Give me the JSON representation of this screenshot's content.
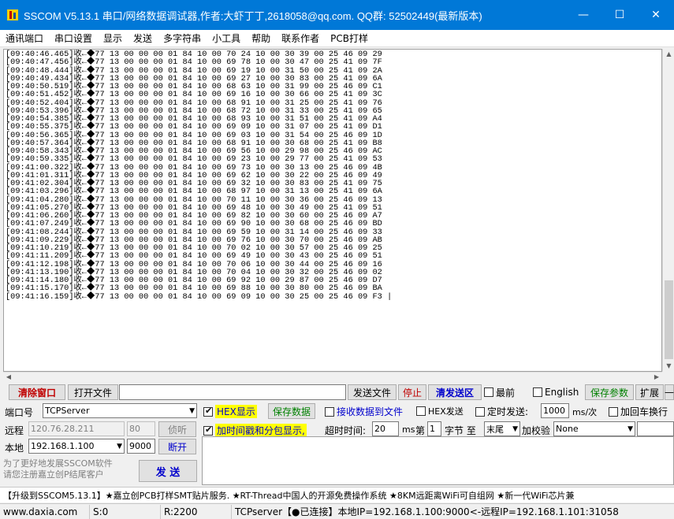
{
  "window": {
    "title": "SSCOM V5.13.1 串口/网络数据调试器,作者:大虾丁丁,2618058@qq.com. QQ群: 52502449(最新版本)",
    "minimize": "—",
    "maximize": "☐",
    "close": "✕"
  },
  "menu": [
    "通讯端口",
    "串口设置",
    "显示",
    "发送",
    "多字符串",
    "小工具",
    "帮助",
    "联系作者",
    "PCB打样"
  ],
  "log": [
    "[09:40:46.465]收←◆77 13 00 00 00 01 84 10 00 70 24 10 00 30 39 00 25 46 09 29",
    "[09:40:47.456]收←◆77 13 00 00 00 01 84 10 00 69 78 10 00 30 47 00 25 41 09 7F",
    "[09:40:48.444]收←◆77 13 00 00 00 01 84 10 00 69 19 10 00 31 50 00 25 41 09 2A",
    "[09:40:49.434]收←◆77 13 00 00 00 01 84 10 00 69 27 10 00 30 83 00 25 41 09 6A",
    "[09:40:50.519]收←◆77 13 00 00 00 01 84 10 00 68 63 10 00 31 99 00 25 46 09 C1",
    "[09:40:51.452]收←◆77 13 00 00 00 01 84 10 00 69 16 10 00 30 66 00 25 41 09 3C",
    "[09:40:52.404]收←◆77 13 00 00 00 01 84 10 00 68 91 10 00 31 25 00 25 41 09 76",
    "[09:40:53.396]收←◆77 13 00 00 00 01 84 10 00 68 72 10 00 31 33 00 25 41 09 65",
    "[09:40:54.385]收←◆77 13 00 00 00 01 84 10 00 68 93 10 00 31 51 00 25 41 09 A4",
    "[09:40:55.375]收←◆77 13 00 00 00 01 84 10 00 69 09 10 00 31 07 00 25 41 09 D1",
    "[09:40:56.365]收←◆77 13 00 00 00 01 84 10 00 69 03 10 00 31 54 00 25 46 09 1D",
    "[09:40:57.364]收←◆77 13 00 00 00 01 84 10 00 68 91 10 00 30 68 00 25 41 09 B8",
    "[09:40:58.343]收←◆77 13 00 00 00 01 84 10 00 69 56 10 00 29 98 00 25 46 09 AC",
    "[09:40:59.335]收←◆77 13 00 00 00 01 84 10 00 69 23 10 00 29 77 00 25 41 09 53",
    "[09:41:00.322]收←◆77 13 00 00 00 01 84 10 00 69 73 10 00 30 13 00 25 46 09 4B",
    "[09:41:01.311]收←◆77 13 00 00 00 01 84 10 00 69 62 10 00 30 22 00 25 46 09 49",
    "[09:41:02.304]收←◆77 13 00 00 00 01 84 10 00 69 32 10 00 30 83 00 25 41 09 75",
    "[09:41:03.296]收←◆77 13 00 00 00 01 84 10 00 68 97 10 00 31 13 00 25 41 09 6A",
    "[09:41:04.280]收←◆77 13 00 00 00 01 84 10 00 70 11 10 00 30 36 00 25 46 09 13",
    "[09:41:05.270]收←◆77 13 00 00 00 01 84 10 00 69 48 10 00 30 49 00 25 41 09 51",
    "[09:41:06.260]收←◆77 13 00 00 00 01 84 10 00 69 82 10 00 30 60 00 25 46 09 A7",
    "[09:41:07.249]收←◆77 13 00 00 00 01 84 10 00 69 90 10 00 30 68 00 25 46 09 BD",
    "[09:41:08.244]收←◆77 13 00 00 00 01 84 10 00 69 59 10 00 31 14 00 25 46 09 33",
    "[09:41:09.229]收←◆77 13 00 00 00 01 84 10 00 69 76 10 00 30 70 00 25 46 09 AB",
    "[09:41:10.219]收←◆77 13 00 00 00 01 84 10 00 70 02 10 00 30 57 00 25 46 09 25",
    "[09:41:11.209]收←◆77 13 00 00 00 01 84 10 00 69 49 10 00 30 43 00 25 46 09 51",
    "[09:41:12.198]收←◆77 13 00 00 00 01 84 10 00 70 06 10 00 30 44 00 25 46 09 16",
    "[09:41:13.190]收←◆77 13 00 00 00 01 84 10 00 70 04 10 00 30 32 00 25 46 09 02",
    "[09:41:14.180]收←◆77 13 00 00 00 01 84 10 00 69 92 10 00 29 87 00 25 46 09 D7",
    "[09:41:15.170]收←◆77 13 00 00 00 01 84 10 00 69 88 10 00 30 80 00 25 46 09 BA",
    "[09:41:16.159]收←◆77 13 00 00 00 01 84 10 00 69 09 10 00 30 25 00 25 46 09 F3 |"
  ],
  "toolbar": {
    "clear": "清除窗口",
    "open_file": "打开文件",
    "send_file": "发送文件",
    "stop": "停止",
    "clear_send": "清发送区",
    "front": "最前",
    "english": "English",
    "save_params": "保存参数",
    "expand": "扩展",
    "dash": "—"
  },
  "net": {
    "port_label": "端口号",
    "port_value": "TCPServer",
    "remote_label": "远程",
    "remote_ip": "120.76.28.211",
    "remote_port": "80",
    "connect": "侦听",
    "local_label": "本地",
    "local_ip": "192.168.1.100",
    "local_port": "9000",
    "open": "断开",
    "promo1": "为了更好地发展SSCOM软件",
    "promo2": "请您注册嘉立创P结尾客户",
    "send": "发 送"
  },
  "options": {
    "hex_display": "HEX显示",
    "save_data": "保存数据",
    "recv_to_file": "接收数据到文件",
    "hex_send": "HEX发送",
    "timed_send": "定时发送:",
    "interval": "1000",
    "interval_unit": "ms/次",
    "add_crlf": "加回车换行",
    "timestamp": "加时间戳和分包显示,",
    "timeout_label": "超时时间:",
    "timeout": "20",
    "ms": "ms",
    "nth": "第",
    "byte_idx": "1",
    "byte_to": "字节 至",
    "end": "末尾",
    "checksum": "加校验",
    "checksum_value": "None"
  },
  "ticker": "【升级到SSCOM5.13.1】★嘉立创PCB打样SMT贴片服务. ★RT-Thread中国人的开源免费操作系统 ★8KM远距离WiFi可自组网 ★新一代WiFi芯片兼",
  "status": {
    "site": "www.daxia.com",
    "sent": "S:0",
    "recv": "R:2200",
    "conn": "TCPserver【●已连接】本地IP=192.168.1.100:9000<-远程IP=192.168.1.101:31058"
  },
  "colors": {
    "titlebar": "#0078d7",
    "accent_red": "#c00000",
    "accent_blue": "#0000cc",
    "accent_green": "#008000"
  }
}
